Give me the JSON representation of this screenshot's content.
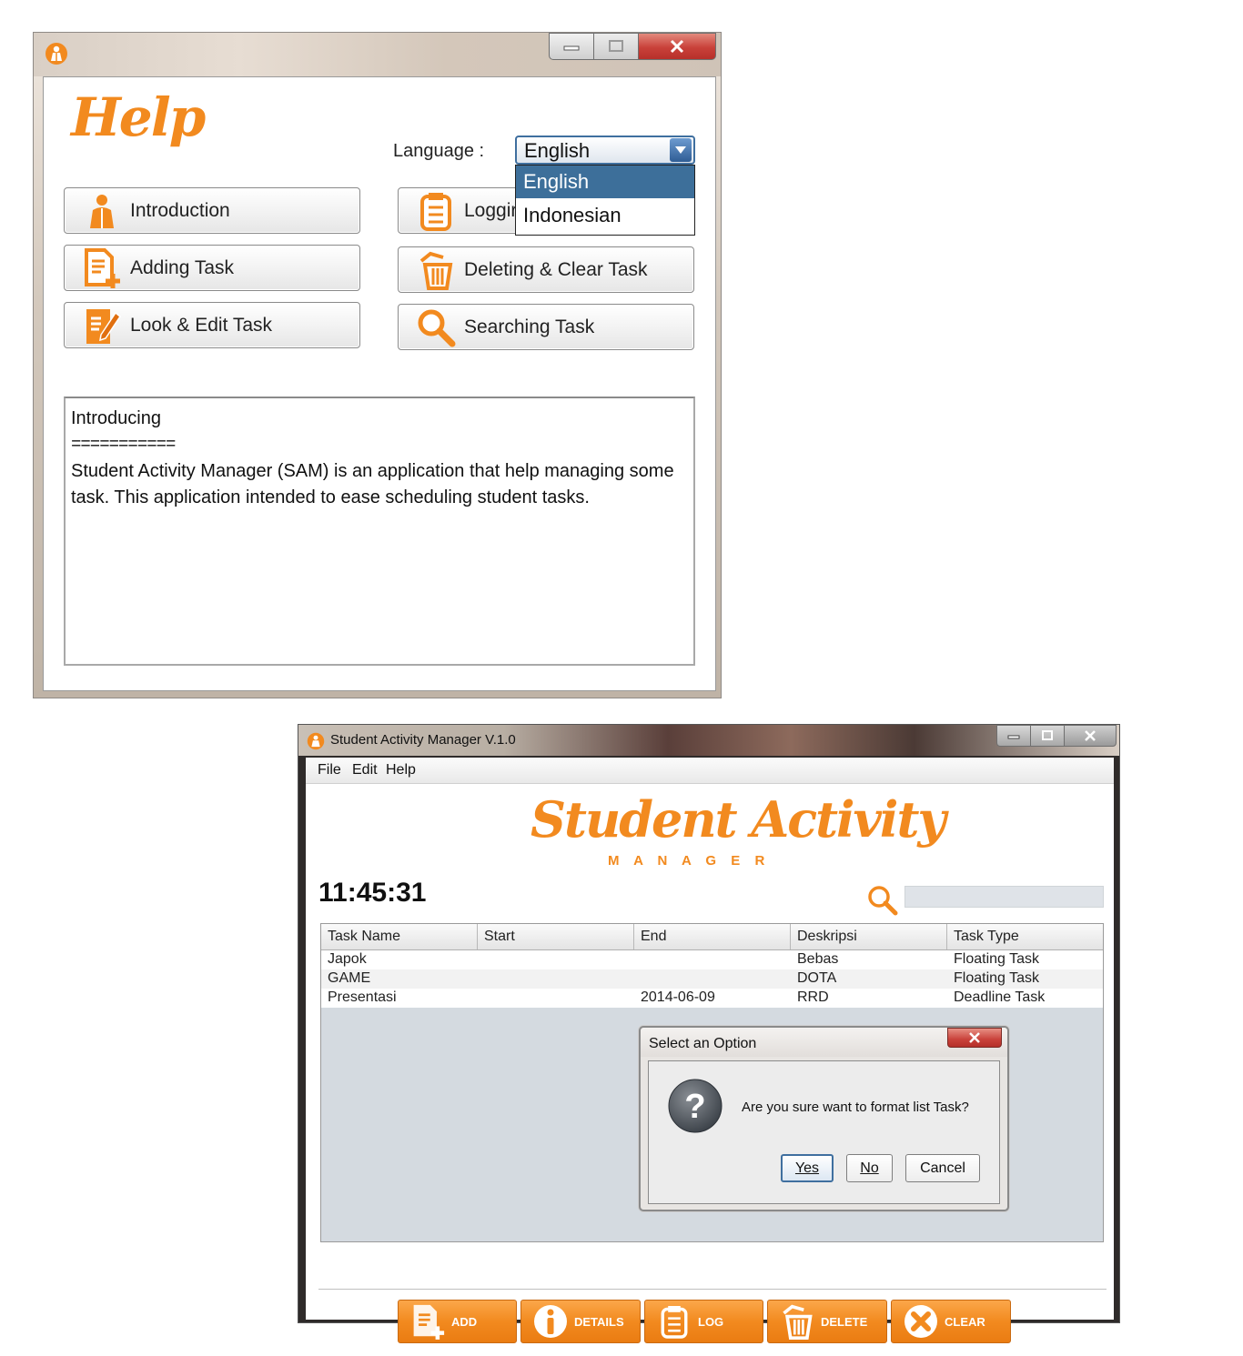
{
  "help_window": {
    "title": "Help",
    "language_label": "Language :",
    "language_selected": "English",
    "language_options": [
      "English",
      "Indonesian"
    ],
    "buttons": {
      "introduction": "Introduction",
      "logging_partial": "Loggir",
      "adding_task": "Adding Task",
      "deleting_clear_task": "Deleting & Clear Task",
      "look_edit_task": "Look & Edit Task",
      "searching_task": "Searching Task"
    },
    "content": {
      "heading": "Introducing",
      "underline": "===========",
      "body": "Student Activity Manager (SAM) is an application that help managing some task. This application intended to ease scheduling student tasks."
    }
  },
  "main_window": {
    "title": "Student Activity Manager V.1.0",
    "menu": [
      "File",
      "Edit",
      "Help"
    ],
    "logo_title": "Student Activity",
    "logo_subtitle": "M A N A G E R",
    "clock": "11:45:31",
    "table": {
      "columns": [
        "Task Name",
        "Start",
        "End",
        "Deskripsi",
        "Task Type"
      ],
      "rows": [
        [
          "Japok",
          "",
          "",
          "Bebas",
          "Floating Task"
        ],
        [
          "GAME",
          "",
          "",
          "DOTA",
          "Floating Task"
        ],
        [
          "Presentasi",
          "",
          "2014-06-09",
          "RRD",
          "Deadline Task"
        ]
      ]
    },
    "dialog": {
      "title": "Select an Option",
      "message": "Are you sure want to format list Task?",
      "yes": "Yes",
      "no": "No",
      "cancel": "Cancel"
    },
    "actions": {
      "add": "ADD",
      "details": "DETAILS",
      "log": "LOG",
      "delete": "DELETE",
      "clear": "CLEAR"
    }
  },
  "colors": {
    "accent_orange": "#f28a1f",
    "selection_blue": "#3d6f9a",
    "close_red": "#c9413a"
  }
}
